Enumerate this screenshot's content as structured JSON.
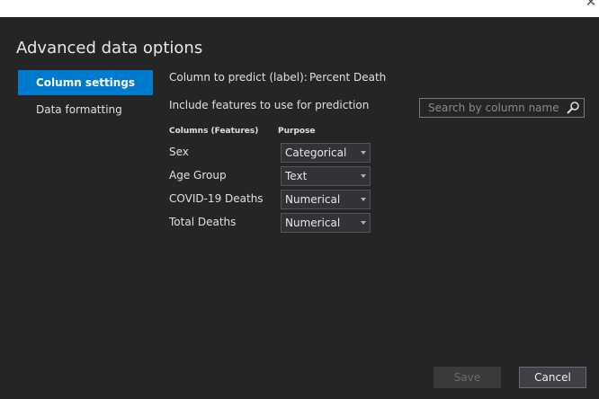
{
  "dialog": {
    "title": "Advanced data options",
    "close_symbol": "✕"
  },
  "sidebar": {
    "items": [
      {
        "label": "Column settings",
        "active": true
      },
      {
        "label": "Data formatting",
        "active": false
      }
    ]
  },
  "main": {
    "predict_label": "Column to predict (label):",
    "predict_value": "Percent Death",
    "include_label": "Include features to use for prediction",
    "search": {
      "placeholder": "Search by column name",
      "value": "",
      "icon": "search-icon"
    },
    "columns_header": "Columns (Features)",
    "purpose_header": "Purpose",
    "rows": [
      {
        "column": "Sex",
        "purpose": "Categorical"
      },
      {
        "column": "Age Group",
        "purpose": "Text"
      },
      {
        "column": "COVID-19 Deaths",
        "purpose": "Numerical"
      },
      {
        "column": "Total Deaths",
        "purpose": "Numerical"
      }
    ]
  },
  "footer": {
    "save_label": "Save",
    "save_enabled": false,
    "cancel_label": "Cancel"
  },
  "colors": {
    "background": "#252526",
    "accent": "#007acc",
    "text": "#e0e0e0",
    "disabled_text": "#6b6b6b"
  }
}
